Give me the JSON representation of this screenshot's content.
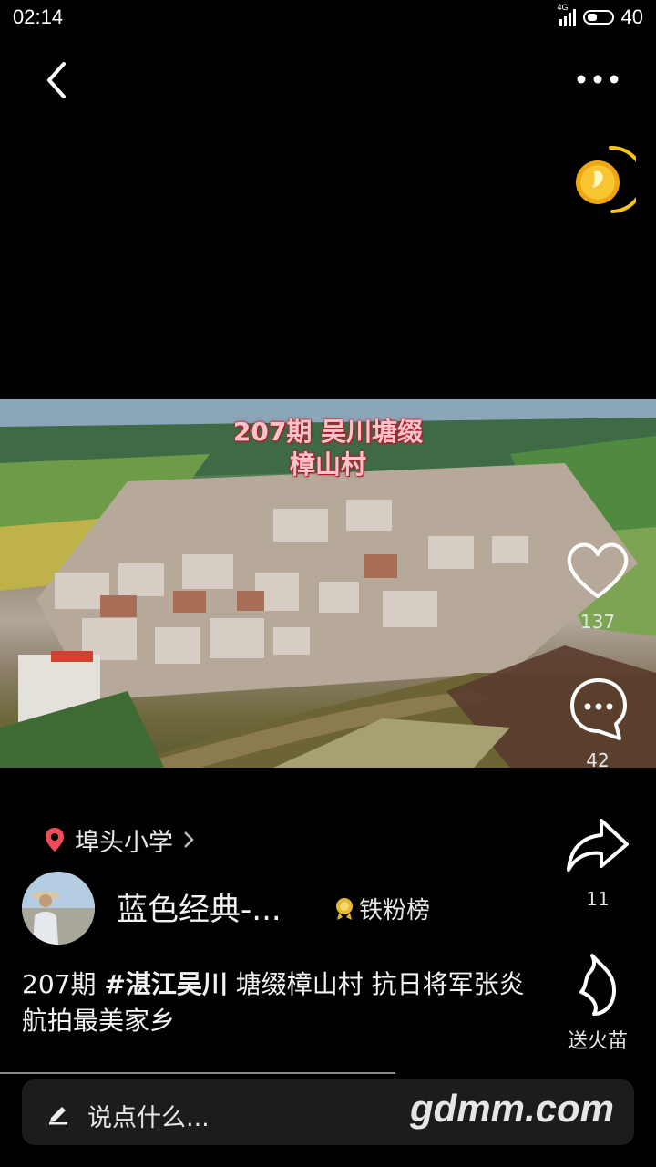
{
  "status": {
    "time": "02:14",
    "network": "4G",
    "battery": "40"
  },
  "colors": {
    "background": "#000000",
    "title_red": "#c0142e",
    "location_pin": "#f04c5c",
    "coin": "#f5c518"
  },
  "icons": {
    "back": "chevron-left-icon",
    "more": "more-horizontal-icon",
    "coin": "coin-icon",
    "like": "heart-icon",
    "comment": "comment-icon",
    "share": "share-icon",
    "fire": "flame-icon",
    "location": "location-pin-icon",
    "edit": "pencil-icon"
  },
  "video": {
    "overlay_title_line1": "207期 吴川塘缀",
    "overlay_title_line2": "樟山村"
  },
  "actions": {
    "likes": "137",
    "comments": "42",
    "shares": "11",
    "fire_label": "送火苗"
  },
  "location": {
    "name": "埠头小学"
  },
  "author": {
    "name": "蓝色经典-...",
    "rank_label": "铁粉榜"
  },
  "description": {
    "prefix": "207期 ",
    "hashtag": "#湛江吴川",
    "text": " 塘缀樟山村 抗日将军张炎 航拍最美家乡"
  },
  "comment_bar": {
    "placeholder": "说点什么..."
  },
  "watermark": "gdmm.com"
}
